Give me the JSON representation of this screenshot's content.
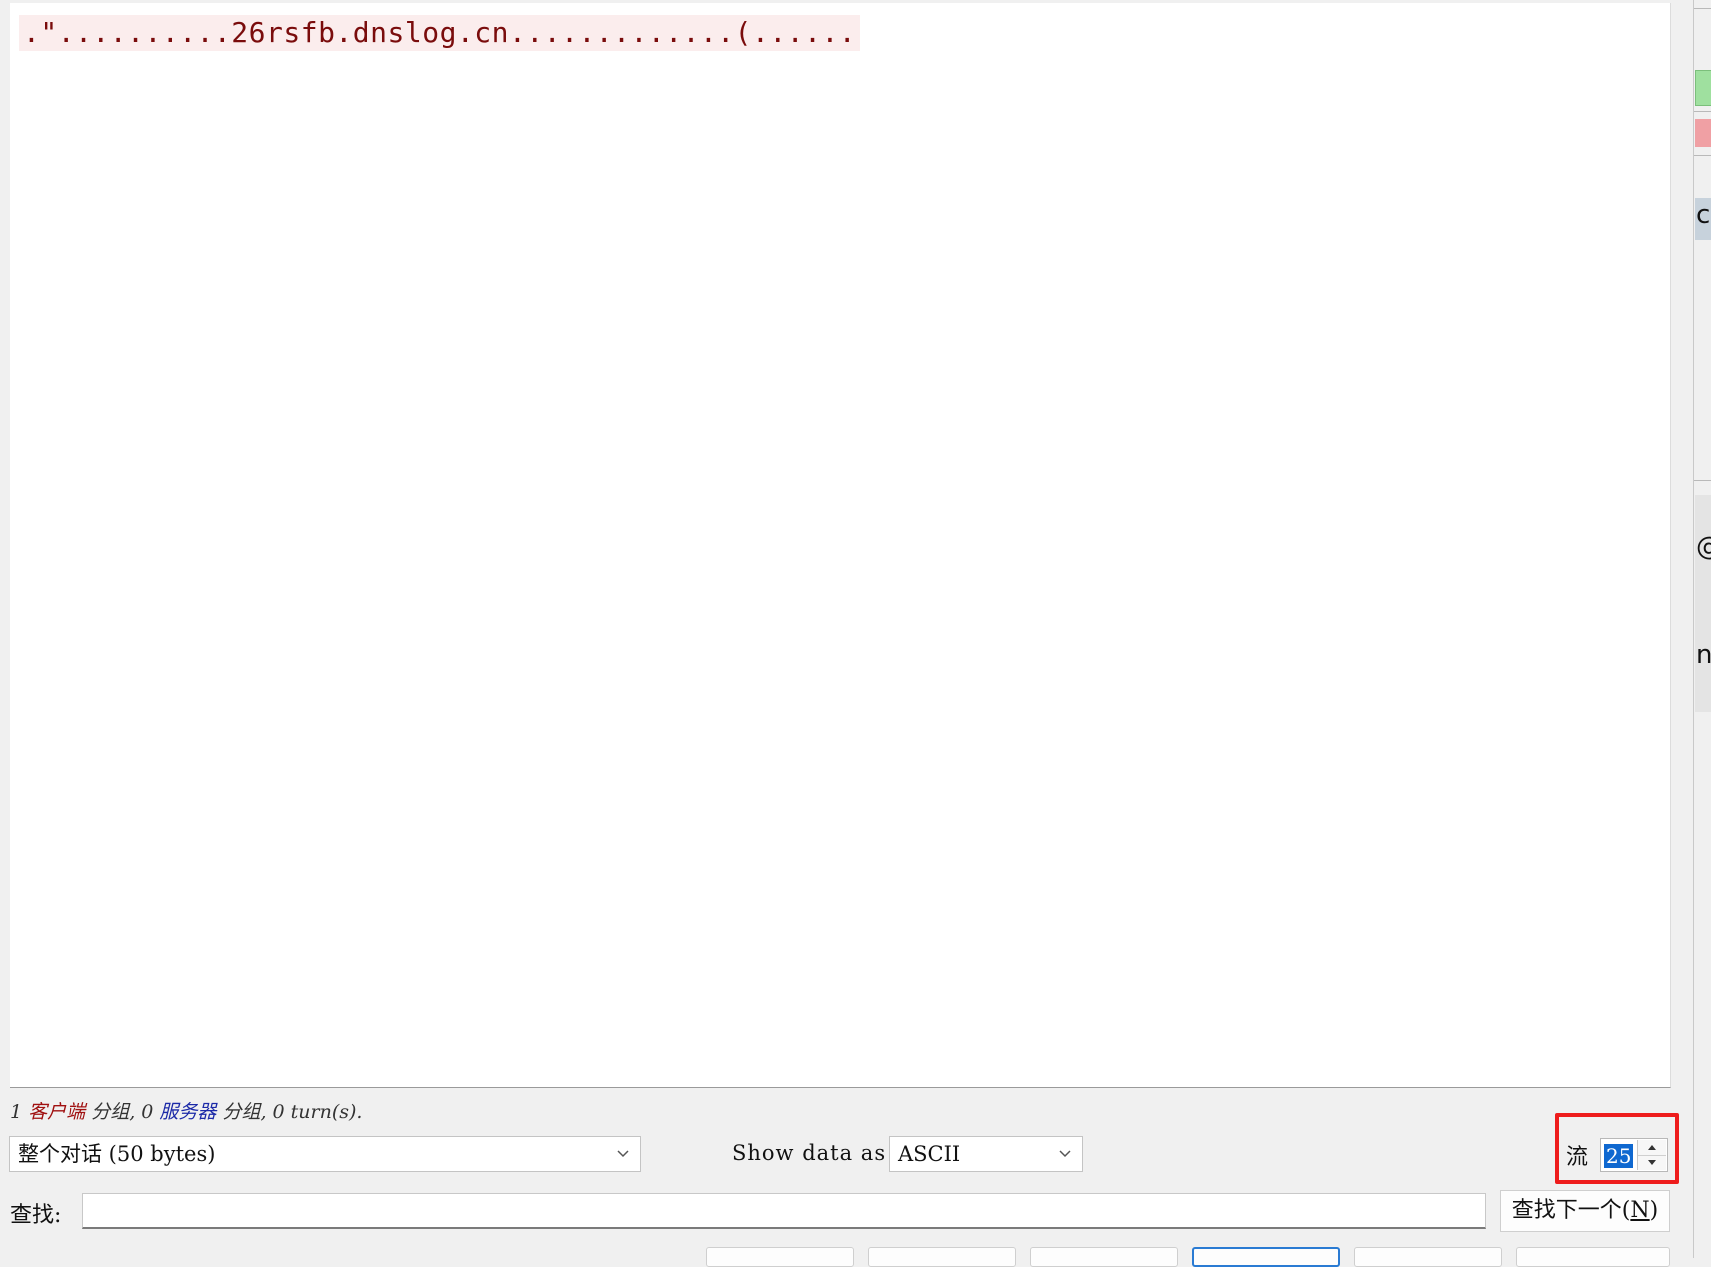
{
  "stream": {
    "content": ".\"..........26rsfb.dnslog.cn.............(......",
    "colors": {
      "client_text": "#7a0c0c",
      "client_bg": "#fbeded"
    }
  },
  "side_strip": {
    "chars": [
      "c",
      "@",
      "n"
    ]
  },
  "status": {
    "count_client": "1",
    "client_label": "客户端",
    "packets_sep1": " 分组, 0 ",
    "server_label": "服务器",
    "packets_sep2": " 分组, 0 turn(s)."
  },
  "controls": {
    "conversation_selected": "整个对话 (50 bytes)",
    "show_data_label": "Show data as",
    "show_data_selected": "ASCII",
    "stream_label": "流",
    "stream_number": "25"
  },
  "find": {
    "label": "查找:",
    "value": "",
    "next_button_main": "查找下一个(",
    "next_button_key": "N",
    "next_button_tail": ")"
  },
  "colors": {
    "highlight_box": "#ee1c1c",
    "selection": "#0f68d0",
    "active_button_border": "#2a7bd3"
  }
}
